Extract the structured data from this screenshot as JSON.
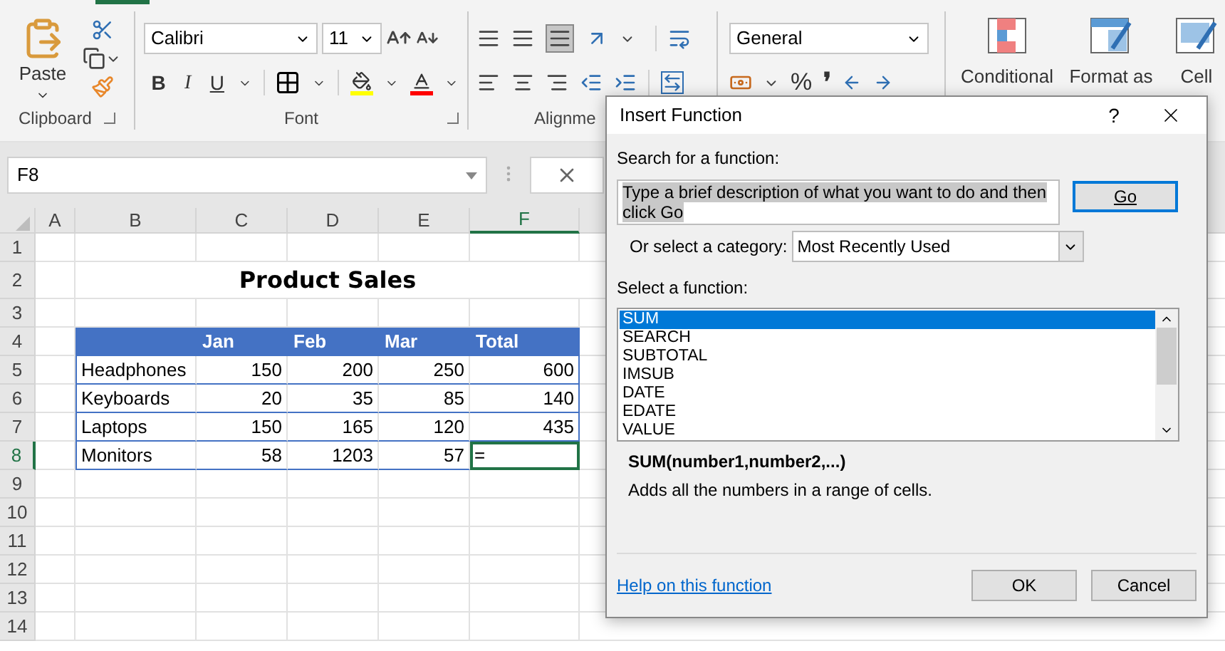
{
  "ribbon": {
    "clipboard": {
      "paste_label": "Paste",
      "group_label": "Clipboard"
    },
    "font": {
      "font_name": "Calibri",
      "font_size": "11",
      "bold": "B",
      "italic": "I",
      "underline": "U",
      "group_label": "Font"
    },
    "alignment": {
      "group_label": "Alignme"
    },
    "number": {
      "format": "General",
      "percent": "%",
      "comma": "❜"
    },
    "styles": {
      "conditional_label": "Conditional",
      "format_table_label": "Format as",
      "cell_styles_label": "Cell"
    }
  },
  "formula_bar": {
    "name_box": "F8"
  },
  "sheet": {
    "column_headers": [
      {
        "label": "A",
        "selected": false
      },
      {
        "label": "B",
        "selected": false
      },
      {
        "label": "C",
        "selected": false
      },
      {
        "label": "D",
        "selected": false
      },
      {
        "label": "E",
        "selected": false
      },
      {
        "label": "F",
        "selected": true
      }
    ],
    "row_numbers": [
      {
        "label": "1",
        "selected": false
      },
      {
        "label": "2",
        "selected": false
      },
      {
        "label": "3",
        "selected": false
      },
      {
        "label": "4",
        "selected": false
      },
      {
        "label": "5",
        "selected": false
      },
      {
        "label": "6",
        "selected": false
      },
      {
        "label": "7",
        "selected": false
      },
      {
        "label": "8",
        "selected": true
      },
      {
        "label": "9",
        "selected": false
      },
      {
        "label": "10",
        "selected": false
      },
      {
        "label": "11",
        "selected": false
      },
      {
        "label": "12",
        "selected": false
      },
      {
        "label": "13",
        "selected": false
      },
      {
        "label": "14",
        "selected": false
      }
    ],
    "title": "Product Sales",
    "table_header": [
      "Jan",
      "Feb",
      "Mar",
      "Total"
    ],
    "table_rows": [
      {
        "product": "Headphones",
        "values": [
          "150",
          "200",
          "250",
          "600"
        ],
        "total_selected": false
      },
      {
        "product": "Keyboards",
        "values": [
          "20",
          "35",
          "85",
          "140"
        ],
        "total_selected": false
      },
      {
        "product": "Laptops",
        "values": [
          "150",
          "165",
          "120",
          "435"
        ],
        "total_selected": false
      },
      {
        "product": "Monitors",
        "values": [
          "58",
          "1203",
          "57",
          "="
        ],
        "total_selected": true
      }
    ]
  },
  "dialog": {
    "title": "Insert Function",
    "help": "?",
    "search_label": "Search for a function:",
    "search_value": "Type a brief description of what you want to do and then click Go",
    "go": "Go",
    "category_label": "Or select a category:",
    "category_value": "Most Recently Used",
    "list_label": "Select a function:",
    "functions": [
      {
        "name": "SUM",
        "selected": true
      },
      {
        "name": "SEARCH",
        "selected": false
      },
      {
        "name": "SUBTOTAL",
        "selected": false
      },
      {
        "name": "IMSUB",
        "selected": false
      },
      {
        "name": "DATE",
        "selected": false
      },
      {
        "name": "EDATE",
        "selected": false
      },
      {
        "name": "VALUE",
        "selected": false
      }
    ],
    "signature": "SUM(number1,number2,...)",
    "description": "Adds all the numbers in a range of cells.",
    "help_link": "Help on this function",
    "ok": "OK",
    "cancel": "Cancel"
  }
}
